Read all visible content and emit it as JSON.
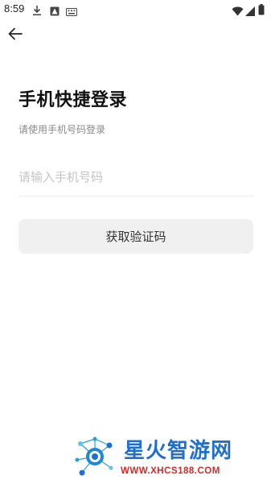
{
  "status_bar": {
    "time": "8:59",
    "icons_left": [
      "download-icon",
      "warning-icon",
      "keyboard-icon"
    ],
    "icons_right": [
      "wifi-icon",
      "signal-icon",
      "battery-icon"
    ]
  },
  "nav": {
    "back_icon": "arrow-left-icon"
  },
  "login": {
    "title": "手机快捷登录",
    "subtitle": "请使用手机号码登录",
    "phone_placeholder": "请输入手机号码",
    "phone_value": "",
    "get_code_label": "获取验证码"
  },
  "watermark": {
    "name": "星火智游网",
    "url": "WWW.XHCS188.COM"
  },
  "colors": {
    "background": "#ffffff",
    "title": "#111111",
    "subtitle": "#8a8a8a",
    "placeholder": "#c4c4c4",
    "button_bg": "#f0f0f0",
    "watermark_blue": "#1e6fd0",
    "watermark_red": "#d42a2a"
  }
}
